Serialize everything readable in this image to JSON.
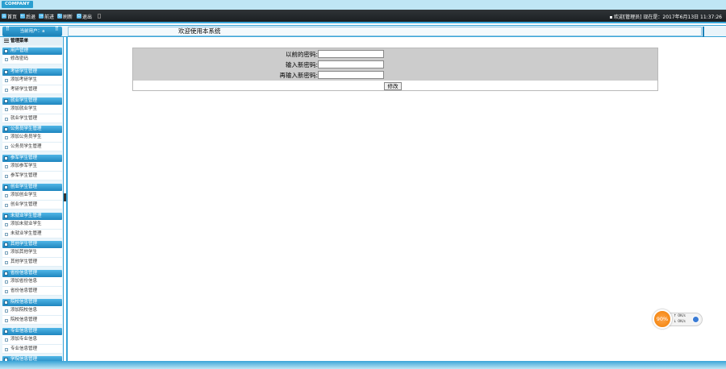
{
  "app": {
    "logo": "COMPANY"
  },
  "toolbar": {
    "buttons": [
      {
        "label": "首页",
        "icon": "home-icon"
      },
      {
        "label": "后退",
        "icon": "back-icon"
      },
      {
        "label": "前进",
        "icon": "forward-icon"
      },
      {
        "label": "刷新",
        "icon": "refresh-icon"
      },
      {
        "label": "退出",
        "icon": "power-icon"
      }
    ],
    "welcome": "欢迎[管理员]   现在是：2017年6月13日 11:37:26"
  },
  "sidebar": {
    "current_user": "当前用户：a",
    "menu_title": "管理菜单",
    "groups": [
      {
        "title": "用户管理",
        "items": [
          "修改密码"
        ]
      },
      {
        "title": "考研学生管理",
        "items": [
          "添加考研学生",
          "考研学生管理"
        ]
      },
      {
        "title": "就业学生管理",
        "items": [
          "添加就业学生",
          "就业学生管理"
        ]
      },
      {
        "title": "公务员学生管理",
        "items": [
          "添加公务员学生",
          "公务员学生管理"
        ]
      },
      {
        "title": "参军学生管理",
        "items": [
          "添加参军学生",
          "参军学生管理"
        ]
      },
      {
        "title": "创业学生管理",
        "items": [
          "添加创业学生",
          "创业学生管理"
        ]
      },
      {
        "title": "未就业学生管理",
        "items": [
          "添加未就业学生",
          "未就业学生管理"
        ]
      },
      {
        "title": "其他学生管理",
        "items": [
          "添加其他学生",
          "其他学生管理"
        ]
      },
      {
        "title": "省份信息管理",
        "items": [
          "添加省份信息",
          "省份信息管理"
        ]
      },
      {
        "title": "院校信息管理",
        "items": [
          "添加院校信息",
          "院校信息管理"
        ]
      },
      {
        "title": "专业信息管理",
        "items": [
          "添加专业信息",
          "专业信息管理"
        ]
      },
      {
        "title": "学院信息管理",
        "items": []
      }
    ]
  },
  "main": {
    "title": "欢迎使用本系统",
    "form": {
      "old_password_label": "以前的密码:",
      "new_password_label": "输入新密码:",
      "confirm_password_label": "再输入新密码:",
      "submit_label": "修改"
    }
  },
  "widget": {
    "percent": "90%",
    "line1_label": "↑",
    "line1_value": "0K/s",
    "line2_label": "↓",
    "line2_value": "0K/s"
  }
}
